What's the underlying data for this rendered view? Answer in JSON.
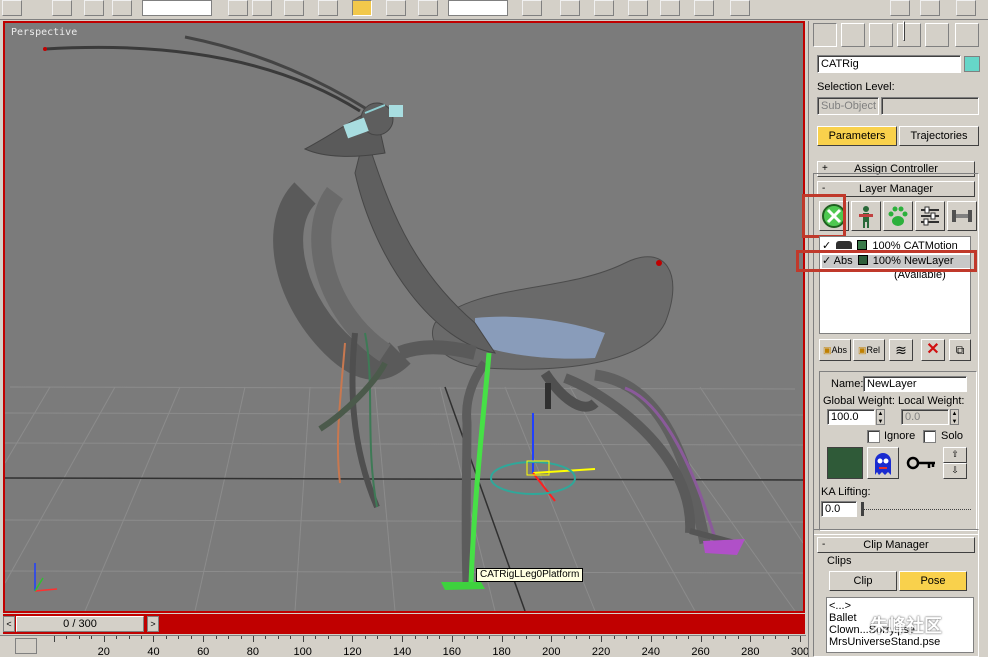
{
  "viewport": {
    "label": "Perspective",
    "tooltip": "CATRigLLeg0Platform"
  },
  "time": {
    "slider_label": "0 / 300",
    "left_arrow": "<",
    "right_arrow": ">",
    "ticks": [
      "20",
      "40",
      "60",
      "80",
      "100",
      "120",
      "140",
      "160",
      "180",
      "200",
      "220",
      "240",
      "260",
      "280",
      "300"
    ]
  },
  "panel": {
    "object_name": "CATRig",
    "object_color": "#66d6c8",
    "selection_level_label": "Selection Level:",
    "sub_object_label": "Sub-Object",
    "tabs": {
      "parameters": "Parameters",
      "trajectories": "Trajectories"
    },
    "assign_controller": {
      "sign": "+",
      "title": "Assign Controller"
    },
    "layer_manager": {
      "sign": "-",
      "title": "Layer Manager",
      "layers": [
        {
          "check": "✓",
          "mode": "",
          "weight_name": "100% CATMotion",
          "color": "#3a7a4a"
        },
        {
          "check": "✓",
          "mode": "Abs",
          "weight_name": "100% NewLayer",
          "color": "#2e5e3a"
        }
      ],
      "available": "(Available)",
      "buttons": {
        "abs": "Abs",
        "rel": "Rel"
      },
      "name_label": "Name:",
      "name_value": "NewLayer",
      "global_weight_label": "Global Weight:",
      "local_weight_label": "Local Weight:",
      "global_weight_value": "100.0",
      "local_weight_value": "0.0",
      "ignore_label": "Ignore",
      "solo_label": "Solo",
      "layer_color": "#2f5a38",
      "ka_lifting_label": "KA Lifting:",
      "ka_lifting_value": "0.0"
    },
    "clip_manager": {
      "sign": "-",
      "title": "Clip Manager",
      "clips_label": "Clips",
      "clip_button": "Clip",
      "pose_button": "Pose",
      "clip_items": [
        "<...>",
        "Ballet",
        "Clown...Sorry.pse",
        "MrsUniverseStand.pse"
      ]
    }
  },
  "watermark": "朱峰社区",
  "colors": {
    "viewport_border": "#c00000",
    "highlight_box": "#c0392b",
    "button_active": "#f9d14c"
  }
}
